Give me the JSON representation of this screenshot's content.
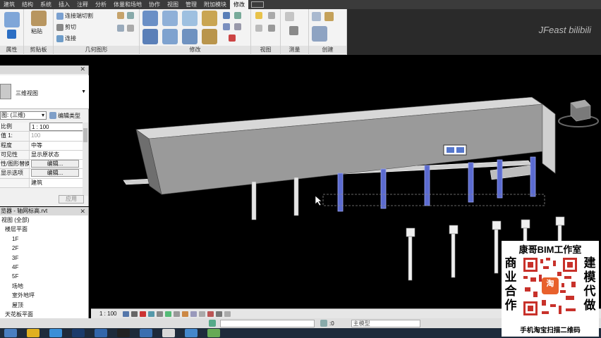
{
  "tabs": [
    "建筑",
    "结构",
    "系统",
    "插入",
    "注释",
    "分析",
    "体量和场地",
    "协作",
    "视图",
    "管理",
    "附加模块",
    "修改"
  ],
  "active_tab": "修改",
  "watermark": "JFeast bilibili",
  "ribbon": {
    "panels": {
      "properties": "属性",
      "clipboard": "剪贴板",
      "geometry": "几何图形",
      "modify": "修改",
      "view": "视图",
      "measure": "测量",
      "create": "创建"
    },
    "paste": "粘贴",
    "cut_join": "连接端切割",
    "cut": "剪切",
    "join": "连接"
  },
  "properties_palette": {
    "type_name": "三维视图",
    "view_selector": "图: (三维)",
    "edit_type": "编辑类型",
    "rows": [
      {
        "key": "比例",
        "value": "1 : 100",
        "style": "input"
      },
      {
        "key": "值 1:",
        "value": "100",
        "style": "grey"
      },
      {
        "key": "程度",
        "value": "中等",
        "style": ""
      },
      {
        "key": "可见性",
        "value": "显示原状态",
        "style": ""
      },
      {
        "key": "性/图形替换",
        "value": "编辑...",
        "style": "button"
      },
      {
        "key": "显示选项",
        "value": "编辑...",
        "style": "button"
      },
      {
        "key": "",
        "value": "建筑",
        "style": ""
      }
    ],
    "apply": "应用"
  },
  "project_browser": {
    "title": "览器 - 轴网标高.rvt",
    "items": [
      {
        "label": "视图 (全部)",
        "indent": 0
      },
      {
        "label": "楼层平面",
        "indent": 1
      },
      {
        "label": "1F",
        "indent": 3
      },
      {
        "label": "2F",
        "indent": 3
      },
      {
        "label": "3F",
        "indent": 3
      },
      {
        "label": "4F",
        "indent": 3
      },
      {
        "label": "5F",
        "indent": 3
      },
      {
        "label": "场地",
        "indent": 3
      },
      {
        "label": "室外地坪",
        "indent": 3
      },
      {
        "label": "屋顶",
        "indent": 3
      },
      {
        "label": "天花板平面",
        "indent": 1
      }
    ]
  },
  "view_control": {
    "scale": "1 : 100"
  },
  "status_bar": {
    "coord": ":0",
    "model": "主模型"
  },
  "ad": {
    "title": "康哥BIM工作室",
    "left": [
      "商",
      "业",
      "合",
      "作"
    ],
    "right": [
      "建",
      "模",
      "代",
      "做"
    ],
    "footer": "手机淘宝扫描二维码",
    "qr_center": "淘"
  },
  "colors": {
    "accent": "#5b6bd0",
    "viewport": "#000000"
  }
}
